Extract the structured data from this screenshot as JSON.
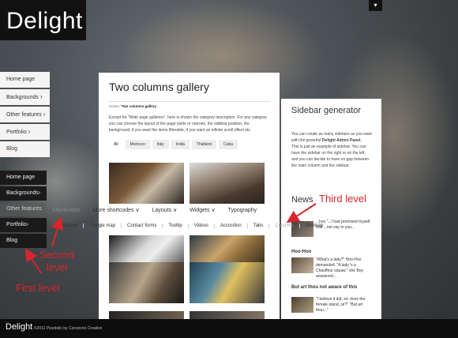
{
  "logo": "Delight",
  "top_toggle_icon": "chevron-down-icon",
  "nav_first": [
    {
      "label": "Home page",
      "arrow": ""
    },
    {
      "label": "Backgrounds",
      "arrow": "›"
    },
    {
      "label": "Other features",
      "arrow": "›"
    },
    {
      "label": "Portfolio",
      "arrow": "›"
    },
    {
      "label": "Blog",
      "arrow": ""
    }
  ],
  "nav_active": [
    {
      "label": "Home page",
      "arrow": ""
    },
    {
      "label": "Backgrounds",
      "arrow": "›"
    },
    {
      "label": "Other features",
      "arrow": ""
    },
    {
      "label": "Portfolio",
      "arrow": "›"
    },
    {
      "label": "Blog",
      "arrow": ""
    }
  ],
  "submenu_second": [
    "Shortcodes",
    "More shortcodes ∨",
    "Layouts ∨",
    "Widgets ∨",
    "Typography"
  ],
  "submenu_third": [
    "Slideshow",
    "Google map",
    "Contact forms",
    "Tooltip",
    "Videos",
    "Accordion",
    "Tabs",
    "Columns",
    "Sitemap"
  ],
  "main": {
    "title": "Two columns gallery",
    "breadcrumb_home": "Home /",
    "breadcrumb_current": "Two columns gallery",
    "intro": "Except for \"Wide page galleries\", here is shown the category description. For any category you can choose the layout of the page (wide or narrow), the sidebar position, the background, if you want the items filterable, if you want an infinite scroll effect etc.",
    "filters": [
      "All",
      "Morocco",
      "Italy",
      "India",
      "Thailand",
      "Cuba"
    ]
  },
  "sidebar": {
    "title": "Sidebar generator",
    "text_a": "You can create as many sidebars as you want with the powerful",
    "text_bold": "Delight Admin Panel.",
    "text_b": "This is just an example of sidebar. You can have the sidebar on the right or on the left, and you can decide to have no gap between the main column and the sidebar.",
    "news_title": "News",
    "news": [
      {
        "title": "",
        "text": "...hes \"...I had promised myself that ...not say to you..."
      },
      {
        "title": "Hoo-Hoo",
        "text": "\"What's a lady?\" Hoo-Hoo demanded. \"A lady 's a Chauffeur squaw.\" she Boy answered..."
      },
      {
        "title": "But art thou not aware of this",
        "text": "\"I believe it did, sir; does the female stand, sir?\" \"But art thou...\""
      }
    ]
  },
  "annotations": {
    "first": "First level",
    "second_a": "Second",
    "second_b": "level",
    "third": "Third level"
  },
  "footer": {
    "logo": "Delight",
    "copyright": "©2011 Pixedelic by Consorzio Creativo"
  },
  "colors": {
    "annotation": "#d9252a",
    "dark": "#111111"
  }
}
